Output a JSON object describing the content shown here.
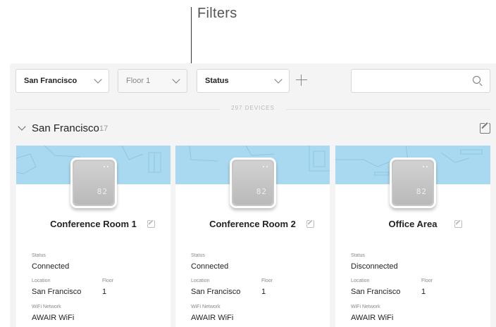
{
  "annotation": {
    "label": "Filters"
  },
  "filters": {
    "location": {
      "value": "San Francisco"
    },
    "floor": {
      "value": "Floor 1"
    },
    "status": {
      "value": "Status"
    },
    "search": {
      "placeholder": ""
    }
  },
  "device_count": "297 DEVICES",
  "group": {
    "title": "San Francisco",
    "count": "17"
  },
  "labels": {
    "status": "Status",
    "location": "Location",
    "floor": "Floor",
    "wifi": "WiFi Network"
  },
  "cards": [
    {
      "name": "Conference Room 1",
      "status": "Connected",
      "location": "San Francisco",
      "floor": "1",
      "wifi": "AWAIR WiFi",
      "reading": "82"
    },
    {
      "name": "Conference Room 2",
      "status": "Connected",
      "location": "San Francisco",
      "floor": "1",
      "wifi": "AWAIR WiFi",
      "reading": "82"
    },
    {
      "name": "Office Area",
      "status": "Disconnected",
      "location": "San Francisco",
      "floor": "1",
      "wifi": "AWAIR WiFi",
      "reading": "82"
    }
  ],
  "colors": {
    "map_bg": "#a9d9f0",
    "panel_bg": "#f4f4f4"
  }
}
